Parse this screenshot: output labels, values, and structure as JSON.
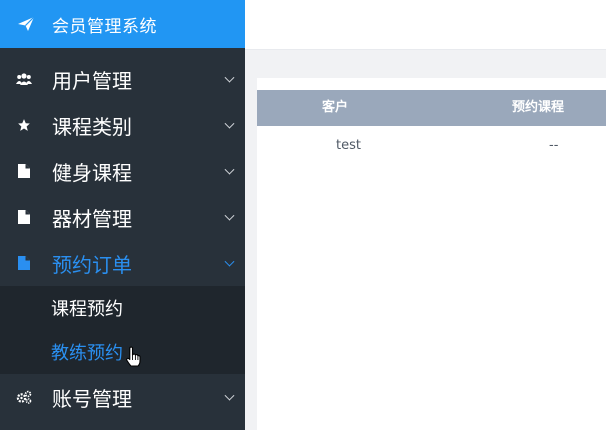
{
  "brand": {
    "title": "会员管理系统",
    "icon": "paper-plane-icon",
    "color": "#2196f3"
  },
  "sidebar": {
    "items": [
      {
        "label": "用户管理",
        "icon": "users-icon"
      },
      {
        "label": "课程类别",
        "icon": "star-icon"
      },
      {
        "label": "健身课程",
        "icon": "file-icon"
      },
      {
        "label": "器材管理",
        "icon": "file-icon"
      },
      {
        "label": "预约订单",
        "icon": "file-icon",
        "active": true,
        "children": [
          {
            "label": "课程预约"
          },
          {
            "label": "教练预约"
          }
        ]
      },
      {
        "label": "账号管理",
        "icon": "gears-icon"
      }
    ],
    "active_color": "#2a8ff0"
  },
  "table": {
    "headers": {
      "customer": "客户",
      "course": "预约课程"
    },
    "rows": [
      {
        "customer": "test",
        "course": "--"
      }
    ]
  }
}
